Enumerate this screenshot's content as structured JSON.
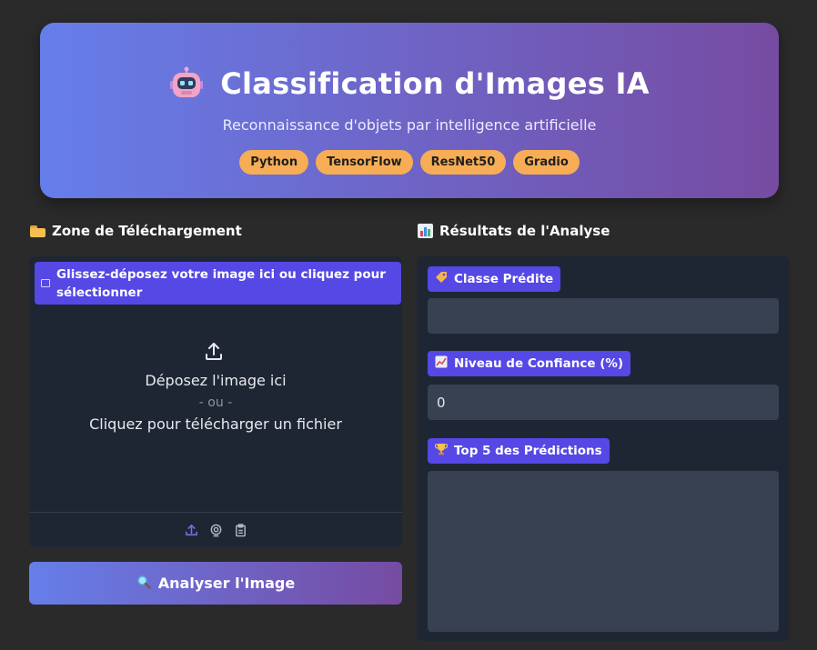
{
  "header": {
    "title": "Classification d'Images IA",
    "subtitle": "Reconnaissance d'objets par intelligence artificielle",
    "badges": [
      "Python",
      "TensorFlow",
      "ResNet50",
      "Gradio"
    ],
    "gradient": [
      "#667eea",
      "#764ba2"
    ],
    "badge_color": "#f6ad55"
  },
  "upload": {
    "section_title": "Zone de Téléchargement",
    "label": "Glissez-déposez votre image ici ou cliquez pour sélectionner",
    "drop_text": "Déposez l'image ici",
    "or_text": "- ou -",
    "click_text": "Cliquez pour télécharger un fichier",
    "toolbar_icons": [
      "upload-icon",
      "webcam-icon",
      "clipboard-icon"
    ]
  },
  "analyze_button": {
    "label": "Analyser l'Image",
    "icon": "magnifier-icon"
  },
  "results": {
    "section_title": "Résultats de l'Analyse",
    "predicted_class": {
      "label": "Classe Prédite",
      "value": ""
    },
    "confidence": {
      "label": "Niveau de Confiance (%)",
      "value": "0"
    },
    "top5": {
      "label": "Top 5 des Prédictions",
      "value": ""
    }
  },
  "colors": {
    "background": "#2a2a2a",
    "panel": "#1f2633",
    "accent": "#5548e4",
    "field": "#374151"
  }
}
